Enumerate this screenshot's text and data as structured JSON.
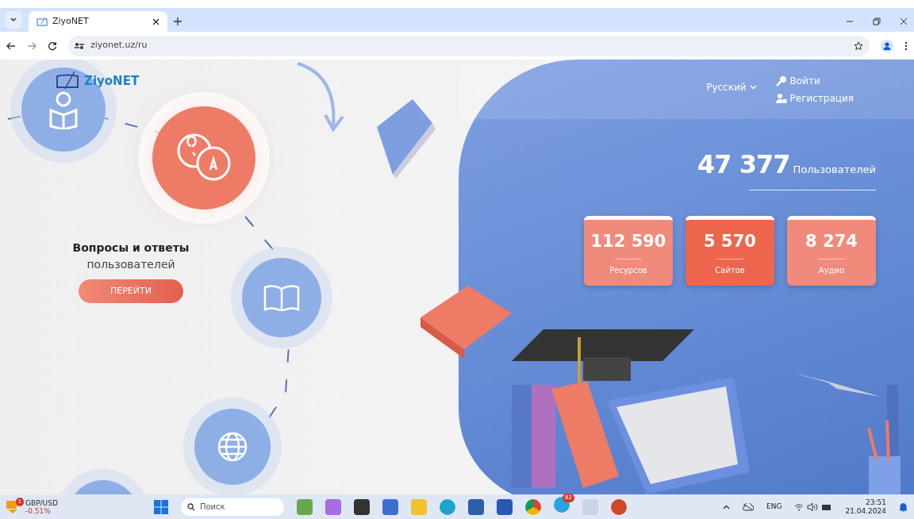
{
  "browser": {
    "tab_title": "ZiyoNET",
    "url": "ziyonet.uz/ru"
  },
  "site": {
    "logo": "ZiyoNET",
    "language": "Русский",
    "login": "Войти",
    "register": "Регистрация"
  },
  "users": {
    "count": "47 377",
    "label": "Пользователей"
  },
  "stats": [
    {
      "value": "112 590",
      "label": "Ресурсов",
      "highlighted": false
    },
    {
      "value": "5 570",
      "label": "Сайтов",
      "highlighted": true
    },
    {
      "value": "8 274",
      "label": "Аудио",
      "highlighted": false
    }
  ],
  "feature": {
    "title": "Вопросы и ответы",
    "subtitle": "пользователей",
    "button": "ПЕРЕЙТИ"
  },
  "taskbar": {
    "ticker": {
      "symbol": "GBP/USD",
      "change": "-0.51%",
      "badge": "1"
    },
    "search_placeholder": "Поиск",
    "messenger_badge": "82",
    "input_language": "ENG",
    "time": "23:51",
    "date": "21.04.2024"
  }
}
